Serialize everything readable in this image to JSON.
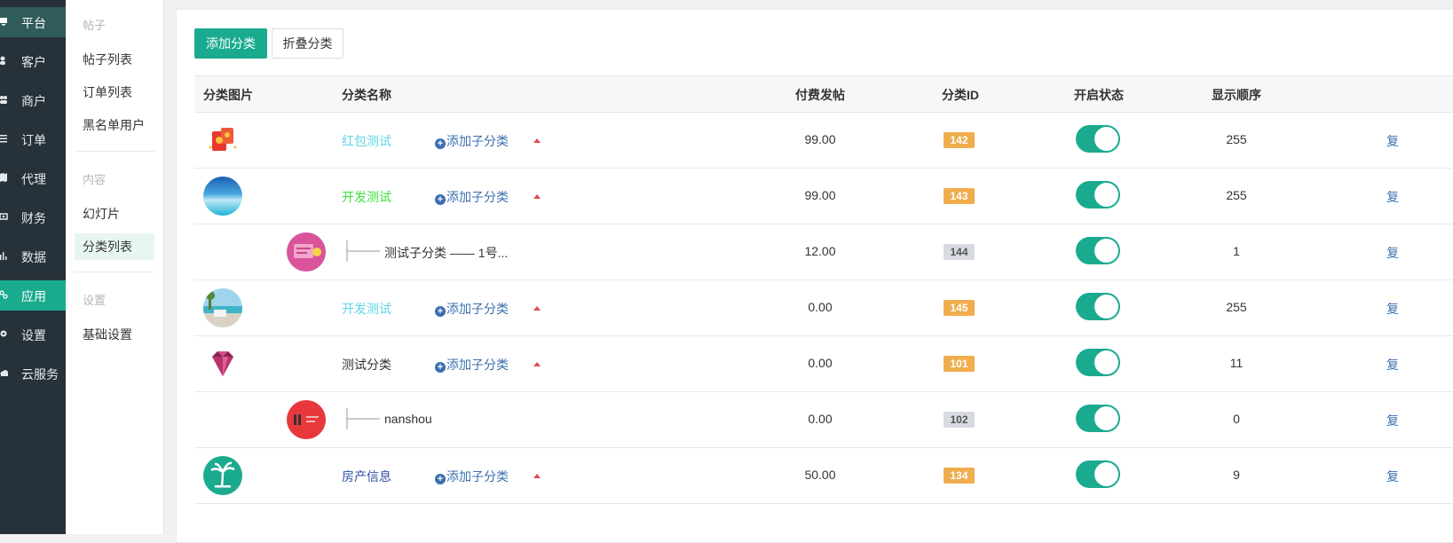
{
  "sidebar": {
    "items": [
      {
        "label": "平台",
        "icon": "monitor-icon",
        "state": "top"
      },
      {
        "label": "客户",
        "icon": "user-icon",
        "state": ""
      },
      {
        "label": "商户",
        "icon": "users-icon",
        "state": ""
      },
      {
        "label": "订单",
        "icon": "list-icon",
        "state": ""
      },
      {
        "label": "代理",
        "icon": "map-icon",
        "state": ""
      },
      {
        "label": "财务",
        "icon": "money-icon",
        "state": ""
      },
      {
        "label": "数据",
        "icon": "bar-chart-icon",
        "state": ""
      },
      {
        "label": "应用",
        "icon": "apps-icon",
        "state": "active"
      },
      {
        "label": "设置",
        "icon": "gear-icon",
        "state": ""
      },
      {
        "label": "云服务",
        "icon": "cloud-icon",
        "state": ""
      }
    ]
  },
  "submenu": {
    "group_posts": "帖子",
    "post_list": "帖子列表",
    "order_list": "订单列表",
    "blacklist": "黑名单用户",
    "group_content": "内容",
    "slides": "幻灯片",
    "category_list": "分类列表",
    "group_settings": "设置",
    "basic_settings": "基础设置"
  },
  "toolbar": {
    "add_category": "添加分类",
    "collapse_category": "折叠分类"
  },
  "table": {
    "headers": {
      "image": "分类图片",
      "name": "分类名称",
      "paid_post": "付费发帖",
      "id": "分类ID",
      "status": "开启状态",
      "order": "显示顺序"
    },
    "add_sub_label": "添加子分类",
    "copy_label": "复",
    "rows": [
      {
        "name": "红包测试",
        "name_color": "#5bd6e8",
        "is_child": false,
        "fee": "99.00",
        "id": "142",
        "badge": "orange",
        "enabled": true,
        "order": "255",
        "thumb": "redpacket"
      },
      {
        "name": "开发测试",
        "name_color": "#3ee03e",
        "is_child": false,
        "fee": "99.00",
        "id": "143",
        "badge": "orange",
        "enabled": true,
        "order": "255",
        "thumb": "ocean"
      },
      {
        "name": "测试子分类 —— 1号...",
        "name_color": "#333333",
        "is_child": true,
        "fee": "12.00",
        "id": "144",
        "badge": "gray",
        "enabled": true,
        "order": "1",
        "thumb": "card"
      },
      {
        "name": "开发测试",
        "name_color": "#5bd6e8",
        "is_child": false,
        "fee": "0.00",
        "id": "145",
        "badge": "orange",
        "enabled": true,
        "order": "255",
        "thumb": "beach"
      },
      {
        "name": "测试分类",
        "name_color": "#333333",
        "is_child": false,
        "fee": "0.00",
        "id": "101",
        "badge": "orange",
        "enabled": true,
        "order": "11",
        "thumb": "gem"
      },
      {
        "name": "nanshou",
        "name_color": "#333333",
        "is_child": true,
        "fee": "0.00",
        "id": "102",
        "badge": "gray",
        "enabled": true,
        "order": "0",
        "thumb": "red"
      },
      {
        "name": "房产信息",
        "name_color": "#2f4fa8",
        "is_child": false,
        "fee": "50.00",
        "id": "134",
        "badge": "orange",
        "enabled": true,
        "order": "9",
        "thumb": "palm"
      }
    ]
  },
  "colors": {
    "primary": "#1aab8e",
    "sidebar_bg": "#263139",
    "badge_orange": "#f0ad4e",
    "link": "#3a6fb0"
  }
}
